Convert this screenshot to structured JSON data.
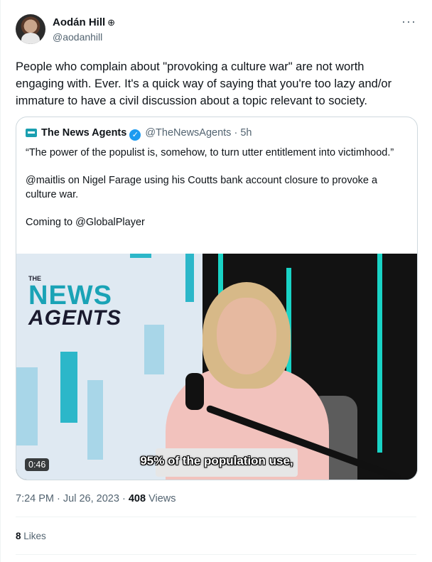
{
  "author": {
    "name": "Aodán Hill",
    "badge": "⊕",
    "handle": "@aodanhill",
    "more": "···"
  },
  "tweet": {
    "text": "People who complain about \"provoking a culture war\" are not worth engaging with. Ever. It's a quick way of saying that you're too lazy and/or immature to have a civil discussion about a topic relevant to society."
  },
  "quote": {
    "name": "The News Agents",
    "verified_glyph": "✓",
    "handle": "@TheNewsAgents",
    "separator": "·",
    "time": "5h",
    "para1": "“The power of the populist is, somehow, to turn utter entitlement into victimhood.”",
    "para2": "@maitlis on Nigel Farage using his Coutts bank account closure to provoke a culture war.",
    "para3": "Coming to @GlobalPlayer",
    "media": {
      "logo_the": "THE",
      "logo_news": "NEWS",
      "logo_agents": "AGENTS",
      "subtitle": "95% of the population use,",
      "duration": "0:46"
    }
  },
  "meta": {
    "time": "7:24 PM",
    "dot": "·",
    "date": "Jul 26, 2023",
    "views_count": "408",
    "views_label": "Views"
  },
  "stats": {
    "likes_count": "8",
    "likes_label": "Likes"
  },
  "colors": {
    "verified": "#1d9bf0",
    "teal": "#19d3c5",
    "secondary_text": "#536471"
  }
}
